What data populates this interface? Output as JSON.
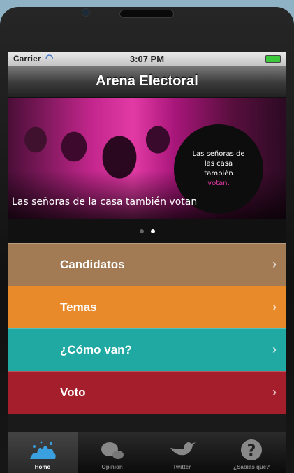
{
  "status_bar": {
    "carrier": "Carrier",
    "time": "3:07 PM"
  },
  "nav": {
    "title": "Arena Electoral"
  },
  "hero": {
    "badge_line1": "Las señoras de",
    "badge_line2": "las casa también",
    "badge_line3": "votan.",
    "caption": "Las señoras de la casa también votan",
    "page_count": 2,
    "active_page": 2
  },
  "menu": [
    {
      "label": "Candidatos",
      "color": "#a27a54"
    },
    {
      "label": "Temas",
      "color": "#e98a2a"
    },
    {
      "label": "¿Cómo van?",
      "color": "#1fa9a2"
    },
    {
      "label": "Voto",
      "color": "#a41e2c"
    }
  ],
  "tabs": [
    {
      "label": "Home",
      "icon": "splash-icon"
    },
    {
      "label": "Opinion",
      "icon": "speech-bubbles-icon"
    },
    {
      "label": "Twitter",
      "icon": "bird-icon"
    },
    {
      "label": "¿Sabías que?",
      "icon": "question-icon"
    }
  ],
  "colors": {
    "magenta": "#e33aa5",
    "tab_active": "#3aa0e0"
  }
}
